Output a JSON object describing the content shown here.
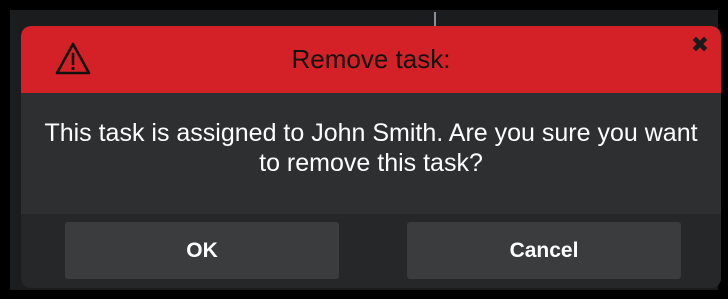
{
  "dialog": {
    "title": "Remove task:",
    "close_glyph": "✖",
    "warning_icon": "warning-triangle-icon",
    "message": "This task is assigned to John Smith. Are you sure you want to remove this task?",
    "ok_label": "OK",
    "cancel_label": "Cancel"
  },
  "colors": {
    "header": "#d42027",
    "body": "#2d2f31",
    "footer": "#262729",
    "button": "#3a3c3e",
    "text": "#ffffff"
  }
}
